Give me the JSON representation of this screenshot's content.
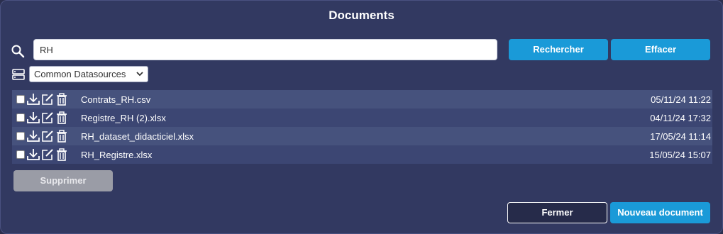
{
  "dialog": {
    "title": "Documents"
  },
  "search": {
    "value": "RH",
    "search_label": "Rechercher",
    "clear_label": "Effacer"
  },
  "datasource": {
    "selected": "Common Datasources"
  },
  "files": [
    {
      "name": "Contrats_RH.csv",
      "date": "05/11/24 11:22"
    },
    {
      "name": "Registre_RH (2).xlsx",
      "date": "04/11/24 17:32"
    },
    {
      "name": "RH_dataset_didacticiel.xlsx",
      "date": "17/05/24 11:14"
    },
    {
      "name": "RH_Registre.xlsx",
      "date": "15/05/24 15:07"
    }
  ],
  "actions": {
    "delete_label": "Supprimer",
    "close_label": "Fermer",
    "new_label": "Nouveau document"
  },
  "icons": {
    "search": "search-icon",
    "datasource": "database-icon",
    "download": "download-icon",
    "edit": "edit-icon",
    "delete": "trash-icon"
  },
  "colors": {
    "background": "#323961",
    "accent": "#1a9ad8",
    "row_light": "#46527d",
    "row_dark": "#3c4673",
    "disabled": "#9a9ca6"
  }
}
